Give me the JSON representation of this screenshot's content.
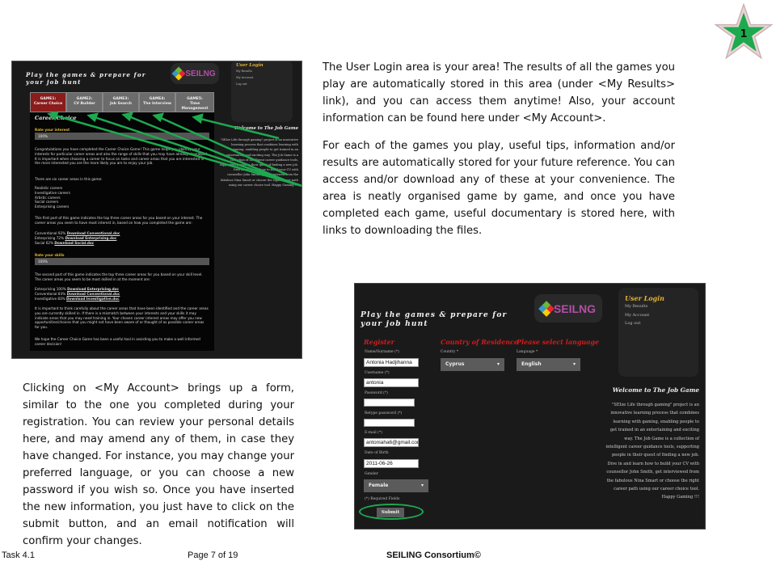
{
  "badge": {
    "number": "1",
    "color": "#1daa4f"
  },
  "right_text": [
    "The User Login area is your area! The results of all the games you play are automatically stored in this area (under <My Results> link), and you can access them anytime! Also, your account information can be found here under <My Account>.",
    "For each of the games you play, useful tips, information and/or results are automatically stored for your future reference. You can access and/or download any of these at your convenience. The area is neatly organised game by game, and once you have completed each game, useful documentary is stored here, with links to downloading the files."
  ],
  "left_text": "Clicking on <My Account> brings up a form, similar to the one you completed during your registration. You can review your personal details here, and may amend any of them, in case they have changed. For instance, you may change your preferred language, or you can choose a new password if you wish so. Once you have inserted the new information, you just have to click on the submit button, and an email notification will confirm your changes.",
  "site": {
    "title": "Play the games & prepare for your job hunt",
    "logo_text": "seiling",
    "user_login": "User Login",
    "my_results": "My Results",
    "my_account": "My Account",
    "log_out": "Log out",
    "welcome_title": "Welcome to The Job Game",
    "welcome_text": "\"SEIze Life through gaming\" project is an innovative learning process that combines learning with gaming, enabling people to get trained in an entertaining and exciting way. The Job Game is a collection of intelligent career guidance tools, supporting people in their quest of finding a new job. Dive in and learn how to build your CV with counsellor John Smith, get interviewed from the fabulous Nina Smart or choose the right career path using our career choice tool. Happy Gaming !!!"
  },
  "shot1": {
    "tabs": [
      {
        "line1": "GAME1:",
        "line2": "Career Choice"
      },
      {
        "line1": "GAME2:",
        "line2": "CV Builder"
      },
      {
        "line1": "GAME3:",
        "line2": "Job Search"
      },
      {
        "line1": "GAME4:",
        "line2": "The Interview"
      },
      {
        "line1": "GAME5:",
        "line2": "Time Management"
      }
    ],
    "heading": "Career Choice",
    "rate_interest": "Rate your interest",
    "interest_value": "100%",
    "congrats": "Congratulations you have completed the Career Choice Game! This game helps you identify your interests for particular career areas and also the range of skills that you may have already developed. It is important when choosing a career to focus on tasks and career areas that you are interested in - the more interested you are the more likely you are to enjoy your job.",
    "six_areas": "There are six career areas in this game:",
    "areas": [
      "Realistic careers",
      "Investigative careers",
      "Artistic careers",
      "Social careers",
      "Enterprising careers"
    ],
    "first_part": "This first part of this game indicates the top three career areas for you based on your interest. The career areas you seem to have most interest in, based on how you completed the game are:",
    "interest_results": [
      {
        "label": "Conventional 92%",
        "link": "Download Conventional.doc"
      },
      {
        "label": "Enterprising 72%",
        "link": "Download Enterprising.doc"
      },
      {
        "label": "Social 62%",
        "link": "Download Social.doc"
      }
    ],
    "rate_skills": "Rate your skills",
    "skills_value": "100%",
    "second_part": "The second part of this game indicates the top three career areas for you based on your skill level. The career areas you seem to be most skilled in at the moment are:",
    "skill_results": [
      {
        "label": "Enterprising 100%",
        "link": "Download Enterprising.doc"
      },
      {
        "label": "Conventional 83%",
        "link": "Download Conventional.doc"
      },
      {
        "label": "Investigative 83%",
        "link": "Download Investigative.doc"
      }
    ],
    "important": "It is important to think carefully about the career areas that have been identified and the career areas you are currently skilled in. If there is a mismatch between your interests and your skills it may indicate areas that you may need training in. Your chosen career interest areas may offer you new opportunities/choices that you might not have been aware of or thought of as possible career areas for you.",
    "hope": "We hope the Career Choice Game has been a useful tool in assisting you to make a well informed career decision!"
  },
  "shot2": {
    "register": "Register",
    "country_heading": "Country of Residence",
    "language_heading": "Please select language",
    "name_label": "Name/Surname (*)",
    "name_value": "Antonia Hadjihanna",
    "username_label": "Username (*)",
    "username_value": "antonia",
    "password_label": "Password (*)",
    "password_value": "",
    "retype_label": "Retype password (*)",
    "retype_value": "",
    "email_label": "E-mail (*)",
    "email_value": "antoniaha6@gmail.com",
    "dob_label": "Date of Birth",
    "dob_value": "2011-06-26",
    "gender_label": "Gender",
    "gender_value": "Female",
    "required": "(*) Required Fields",
    "submit": "Submit",
    "country_label": "Country *",
    "country_value": "Cyprus",
    "language_label": "Language *",
    "language_value": "English"
  },
  "footer": {
    "left": "Task 4.1",
    "center": "Page 7 of 19",
    "right": "SEILING Consortium©"
  },
  "colors": {
    "highlight": "#1daa4f",
    "heading_red": "#d21b1b",
    "gold": "#e1b431"
  }
}
